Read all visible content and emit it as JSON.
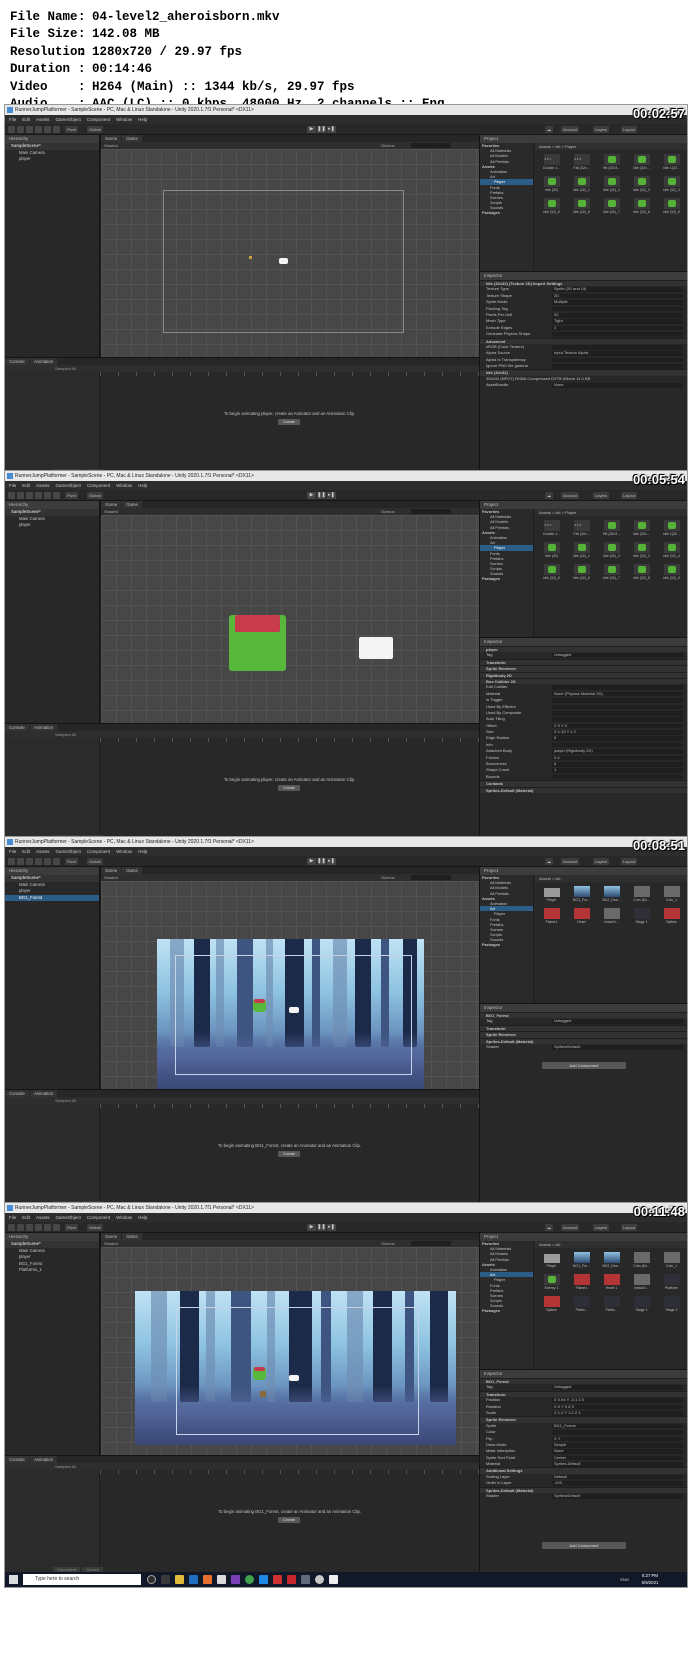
{
  "info": {
    "rows": [
      {
        "key": "File Name",
        "value": "04-level2_aheroisborn.mkv"
      },
      {
        "key": "File Size",
        "value": "142.08 MB"
      },
      {
        "key": "Resolution",
        "value": "1280x720 / 29.97 fps"
      },
      {
        "key": "Duration",
        "value": "00:14:46"
      },
      {
        "key": "Video",
        "value": "H264 (Main) :: 1344 kb/s, 29.97 fps"
      },
      {
        "key": "Audio",
        "value": "AAC (LC) :: 0 kbps, 48000 Hz, 2 channels :: Eng"
      }
    ]
  },
  "editor": {
    "window_title": "RunnerJumpPlatformer - SampleScene - PC, Mac & Linux Standalone - Unity 2020.1.7f1 Personal* <DX11>",
    "menu": [
      "File",
      "Edit",
      "Assets",
      "GameObject",
      "Component",
      "Window",
      "Help"
    ],
    "pivot": "Pivot",
    "global": "Global",
    "account": "Account",
    "layers": "Layers",
    "layout": "Layout",
    "hierarchy_tab": "Hierarchy",
    "scene_tab": "Scene",
    "game_tab": "Game",
    "shading": "Shaded",
    "gizmos": "Gizmos",
    "console_tab": "Console",
    "animation_tab": "Animation",
    "samples": "Samples 60",
    "create_btn": "Create",
    "dopesheet": "Dopesheet",
    "curves": "Curves",
    "project_tab": "Project",
    "inspector_tab": "Inspector",
    "search_placeholder": "Type here to search",
    "lang": "ENG",
    "add_component": "Add Component",
    "favorites": "Favorites",
    "fav_items": [
      "All Materials",
      "All Models",
      "All Prefabs"
    ],
    "assets_root": "Assets",
    "packages": "Packages"
  },
  "frames": [
    {
      "timestamp": "00:02:57",
      "clock": "5:18 PM",
      "date": "6/9/2021",
      "hierarchy": [
        "SampleScene*",
        "Main Camera",
        "player"
      ],
      "tree": [
        "Animation",
        "Art",
        "Player",
        "Fonts",
        "Prefabs",
        "Scenes",
        "Scripts",
        "Sounds"
      ],
      "crumb": "Assets > Art > Player",
      "assets": [
        "Double J...",
        "Fall (32x...",
        "Hit (32x3...",
        "Idle (32x...",
        "Idle 1(32...",
        "Idle (32)",
        "Idle (32)_1",
        "Idle (32)_2",
        "Idle (32)_3",
        "Idle (32)_4",
        "Idle (32)_5",
        "Idle (32)_6",
        "Idle (32)_7",
        "Idle (32)_8",
        "Idle (32)_9"
      ],
      "anim_msg": "To begin animating player, create an Animator and an Animation Clip.",
      "inspector": [
        {
          "label": "Idle (32x32) (Texture 2D) Import Settings",
          "kind": "hdr"
        },
        {
          "label": "Texture Type",
          "val": "Sprite (2D and UI)"
        },
        {
          "label": "Texture Shape",
          "val": "2D"
        },
        {
          "label": "Sprite Mode",
          "val": "Multiple"
        },
        {
          "label": "Packing Tag",
          "val": ""
        },
        {
          "label": "Pixels Per Unit",
          "val": "32"
        },
        {
          "label": "Mesh Type",
          "val": "Tight"
        },
        {
          "label": "Extrude Edges",
          "val": "1"
        },
        {
          "label": "Generate Physics Shape",
          "val": ""
        },
        {
          "label": "Advanced",
          "kind": "hdr"
        },
        {
          "label": "sRGB (Color Texture)",
          "val": ""
        },
        {
          "label": "Alpha Source",
          "val": "Input Texture Alpha"
        },
        {
          "label": "Alpha Is Transparency",
          "val": ""
        },
        {
          "label": "Ignore PNG file gamma",
          "val": ""
        },
        {
          "label": "Idle (32x32)",
          "kind": "hdr"
        },
        {
          "label": "352x32 (NPOT) RGBA Compressed DXT5 UNorm 11.0 KB",
          "kind": "note"
        },
        {
          "label": "AssetBundle",
          "val": "None"
        }
      ]
    },
    {
      "timestamp": "00:05:54",
      "clock": "5:21 PM",
      "date": "6/9/2021",
      "hierarchy": [
        "SampleScene*",
        "Main Camera",
        "player"
      ],
      "tree": [
        "Animation",
        "Art",
        "Player",
        "Fonts",
        "Prefabs",
        "Scenes",
        "Scripts",
        "Sounds"
      ],
      "crumb": "Assets > Art > Player",
      "assets": [
        "Double J...",
        "Fall (32x...",
        "Hit (32x3...",
        "Idle (32x...",
        "Idle 1(32...",
        "Idle (32)",
        "Idle (32)_1",
        "Idle (32)_2",
        "Idle (32)_3",
        "Idle (32)_4",
        "Idle (32)_5",
        "Idle (32)_6",
        "Idle (32)_7",
        "Idle (32)_8",
        "Idle (32)_9"
      ],
      "anim_msg": "To begin animating player, create an Animator and an Animation Clip.",
      "inspector": [
        {
          "label": "player",
          "kind": "hdr"
        },
        {
          "label": "Tag",
          "val": "Untagged"
        },
        {
          "label": "Transform",
          "kind": "hdr"
        },
        {
          "label": "Sprite Renderer",
          "kind": "hdr"
        },
        {
          "label": "Rigidbody 2D",
          "kind": "hdr"
        },
        {
          "label": "Box Collider 2D",
          "kind": "hdr"
        },
        {
          "label": "Edit Collider",
          "val": ""
        },
        {
          "label": "Material",
          "val": "None (Physics Material 2D)"
        },
        {
          "label": "Is Trigger",
          "val": ""
        },
        {
          "label": "Used By Effector",
          "val": ""
        },
        {
          "label": "Used By Composite",
          "val": ""
        },
        {
          "label": "Auto Tiling",
          "val": ""
        },
        {
          "label": "Offset",
          "val": "X 0   Y 0"
        },
        {
          "label": "Size",
          "val": "X 1.15   Y 1.2"
        },
        {
          "label": "Edge Radius",
          "val": "0"
        },
        {
          "label": "Info",
          "val": ""
        },
        {
          "label": "Attached Body",
          "val": "player (Rigidbody 2D)"
        },
        {
          "label": "Friction",
          "val": "0.4"
        },
        {
          "label": "Bounciness",
          "val": "0"
        },
        {
          "label": "Shape Count",
          "val": "1"
        },
        {
          "label": "Bounds",
          "val": ""
        },
        {
          "label": "Contacts",
          "kind": "hdr"
        },
        {
          "label": "Sprites-Default (Material)",
          "kind": "hdr"
        }
      ]
    },
    {
      "timestamp": "00:08:51",
      "clock": "5:24 PM",
      "date": "6/9/2021",
      "hierarchy": [
        "SampleScene*",
        "Main Camera",
        "player",
        "BG1_Forest"
      ],
      "tree": [
        "Animation",
        "Art",
        "Player",
        "Fonts",
        "Prefabs",
        "Scenes",
        "Scripts",
        "Sounds"
      ],
      "crumb": "Assets > Art",
      "assets": [
        "Player",
        "BG1_For...",
        "BG2_Des...",
        "Coin (64...",
        "Coin_1",
        "Flame1",
        "Heart",
        "InstaGr...",
        "Stage 1",
        "Spikes"
      ],
      "anim_msg": "To begin animating BG1_Forest, create an Animator and an Animation Clip.",
      "inspector": [
        {
          "label": "BG1_Forest",
          "kind": "hdr"
        },
        {
          "label": "Tag",
          "val": "Untagged"
        },
        {
          "label": "Transform",
          "kind": "hdr"
        },
        {
          "label": "Sprite Renderer",
          "kind": "hdr"
        },
        {
          "label": "Sprites-Default (Material)",
          "kind": "hdr"
        },
        {
          "label": "Shader",
          "val": "Sprites/Default"
        }
      ]
    },
    {
      "timestamp": "00:11:48",
      "clock": "5:27 PM",
      "date": "6/9/2021",
      "hierarchy": [
        "SampleScene*",
        "Main Camera",
        "player",
        "BG1_Forest",
        "Platforms_1"
      ],
      "tree": [
        "Animation",
        "Art",
        "Player",
        "Fonts",
        "Prefabs",
        "Scenes",
        "Scripts",
        "Sounds"
      ],
      "crumb": "Assets > Art",
      "assets": [
        "Player",
        "BG1_For...",
        "BG2_Des...",
        "Coin (64...",
        "Coin_1",
        "Enemy 1",
        "Flame1",
        "Heart 1",
        "InstaGr...",
        "Platform",
        "Spikes",
        "Platfo...",
        "Platfo...",
        "Stage 1",
        "Stage 2"
      ],
      "anim_msg": "To begin animating BG1_Forest, create an Animator and an Animation Clip.",
      "inspector": [
        {
          "label": "BG1_Forest",
          "kind": "hdr"
        },
        {
          "label": "Tag",
          "val": "Untagged"
        },
        {
          "label": "Transform",
          "kind": "hdr"
        },
        {
          "label": "Position",
          "val": "X 0.94   Y -0.1   Z 0"
        },
        {
          "label": "Rotation",
          "val": "X 0   Y 0   Z 0"
        },
        {
          "label": "Scale",
          "val": "X 1.2   Y 1.2   Z 1"
        },
        {
          "label": "Sprite Renderer",
          "kind": "hdr"
        },
        {
          "label": "Sprite",
          "val": "BG1_Forest"
        },
        {
          "label": "Color",
          "val": ""
        },
        {
          "label": "Flip",
          "val": "X  Y"
        },
        {
          "label": "Draw Mode",
          "val": "Simple"
        },
        {
          "label": "Mask Interaction",
          "val": "None"
        },
        {
          "label": "Sprite Sort Point",
          "val": "Center"
        },
        {
          "label": "Material",
          "val": "Sprites-Default"
        },
        {
          "label": "Additional Settings",
          "kind": "hdr"
        },
        {
          "label": "Sorting Layer",
          "val": "Default"
        },
        {
          "label": "Order in Layer",
          "val": "-100"
        },
        {
          "label": "Sprites-Default (Material)",
          "kind": "hdr"
        },
        {
          "label": "Shader",
          "val": "Sprites/Default"
        }
      ]
    }
  ]
}
